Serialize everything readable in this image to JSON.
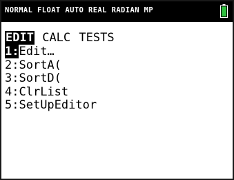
{
  "status_bar": {
    "mode_text": "NORMAL FLOAT AUTO REAL RADIAN MP",
    "battery_color": "#2fbf3f"
  },
  "tabs": [
    {
      "label": "EDIT",
      "active": true
    },
    {
      "label": "CALC",
      "active": false
    },
    {
      "label": "TESTS",
      "active": false
    }
  ],
  "menu_items": [
    {
      "number": "1:",
      "label": "Edit…",
      "selected": true
    },
    {
      "number": "2:",
      "label": "SortA(",
      "selected": false
    },
    {
      "number": "3:",
      "label": "SortD(",
      "selected": false
    },
    {
      "number": "4:",
      "label": "ClrList",
      "selected": false
    },
    {
      "number": "5:",
      "label": "SetUpEditor",
      "selected": false
    }
  ]
}
